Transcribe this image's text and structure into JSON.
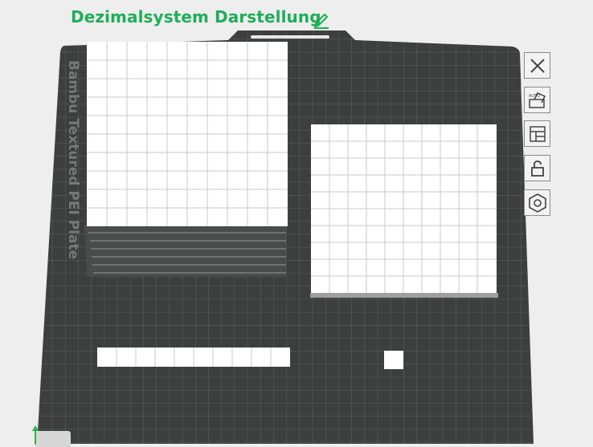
{
  "title": "Dezimalsystem Darstellung",
  "plate": {
    "label": "Bambu Textured PEI Plate"
  },
  "toolbar": {
    "buttons": [
      {
        "name": "close-button",
        "icon": "close-icon"
      },
      {
        "name": "auto-orient-button",
        "icon": "auto-orient-icon"
      },
      {
        "name": "arrange-button",
        "icon": "layout-icon"
      },
      {
        "name": "lock-button",
        "icon": "lock-icon"
      },
      {
        "name": "plate-settings-button",
        "icon": "hexagon-gear-icon"
      }
    ]
  },
  "objects": [
    {
      "name": "thousand-cube",
      "kind": "cube",
      "units": 1000
    },
    {
      "name": "hundred-flat",
      "kind": "flat",
      "units": 100
    },
    {
      "name": "ten-rod",
      "kind": "rod",
      "units": 10
    },
    {
      "name": "one-unit",
      "kind": "unit",
      "units": 1
    }
  ],
  "colors": {
    "accent": "#1fae57",
    "plate": "#3d3e3e",
    "grid": "#6a6b6b",
    "object": "#ffffff"
  }
}
